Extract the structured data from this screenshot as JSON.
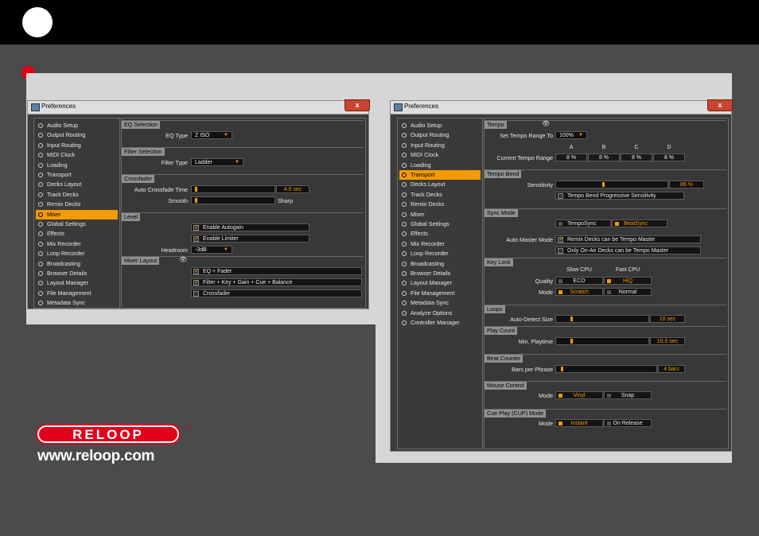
{
  "window_title": "Preferences",
  "close_glyph": "x",
  "colors": {
    "accent": "#f39a00",
    "brand_red": "#e2001a"
  },
  "sidebar_left": [
    "Audio Setup",
    "Output Routing",
    "Input Routing",
    "MIDI Clock",
    "Loading",
    "Transport",
    "Decks Layout",
    "Track Decks",
    "Remix Decks",
    "Mixer",
    "Global Settings",
    "Effects",
    "Mix Recorder",
    "Loop Recorder",
    "Broadcasting",
    "Browser Details",
    "Layout Manager",
    "File Management",
    "Metadata Sync"
  ],
  "sidebar_right": [
    "Audio Setup",
    "Output Routing",
    "Input Routing",
    "MIDI Clock",
    "Loading",
    "Transport",
    "Decks Layout",
    "Track Decks",
    "Remix Decks",
    "Mixer",
    "Global Settings",
    "Effects",
    "Mix Recorder",
    "Loop Recorder",
    "Broadcasting",
    "Browser Details",
    "Layout Manager",
    "File Management",
    "Metadata Sync",
    "Analyze Options",
    "Controller Manager"
  ],
  "mixer": {
    "eq_selection": "EQ Selection",
    "eq_type_label": "EQ Type",
    "eq_type_value": "Z ISO",
    "filter_selection": "Filter Selection",
    "filter_type_label": "Filter Type",
    "filter_type_value": "Ladder",
    "crossfader": "Crossfader",
    "auto_crossfade_label": "Auto Crossfade Time",
    "auto_crossfade_value": "4.0 sec",
    "smooth_label": "Smooth",
    "sharp_label": "Sharp",
    "level": "Level",
    "enable_autogain": "Enable Autogain",
    "enable_limiter": "Enable Limiter",
    "headroom_label": "Headroom",
    "headroom_value": "-3dB",
    "mixer_layout": "Mixer Layout",
    "eq_fader": "EQ + Fader",
    "filter_key_gain": "Filter + Key + Gain + Cue + Balance",
    "crossfader_opt": "Crossfader"
  },
  "transport": {
    "tempo": "Tempo",
    "set_tempo_range_label": "Set Tempo Range To",
    "set_tempo_range_value": "100%",
    "deck_letters": [
      "A",
      "B",
      "C",
      "D"
    ],
    "current_tempo_range_label": "Current Tempo Range",
    "current_tempo_values": [
      "8 %",
      "8 %",
      "8 %",
      "8 %"
    ],
    "tempo_bend": "Tempo Bend",
    "sensitivity_label": "Sensitivity",
    "sensitivity_value": "86 %",
    "tempo_bend_progressive": "Tempo Bend Progressive Sensitivity",
    "sync_mode": "Sync Mode",
    "temposync": "TempoSync",
    "beatsync": "BeatSync",
    "auto_master_label": "Auto Master Mode",
    "remix_master": "Remix Decks can be Tempo Master",
    "onair_master": "Only On-Air Decks can be Tempo Master",
    "key_lock": "Key Lock",
    "slow_cpu": "Slow CPU",
    "fast_cpu": "Fast CPU",
    "quality_label": "Quality",
    "eco": "ECO",
    "hiq": "HiQ",
    "mode_label": "Mode",
    "scratch": "Scratch",
    "normal": "Normal",
    "loops": "Loops",
    "auto_detect_label": "Auto-Detect Size",
    "auto_detect_value": "10 sec",
    "play_count": "Play Count",
    "min_playtime_label": "Min. Playtime",
    "min_playtime_value": "10.0 sec",
    "beat_counter": "Beat Counter",
    "bars_per_phrase_label": "Bars per Phrase",
    "bars_per_phrase_value": "4 bars",
    "mouse_control": "Mouse Control",
    "vinyl": "Vinyl",
    "snap": "Snap",
    "cue_play": "Cue Play (CUP) Mode",
    "instant": "Instant",
    "on_release": "On Release"
  },
  "brand": {
    "logo_text": "RELOOP",
    "logo_mark": "®",
    "website": "www.reloop.com"
  }
}
